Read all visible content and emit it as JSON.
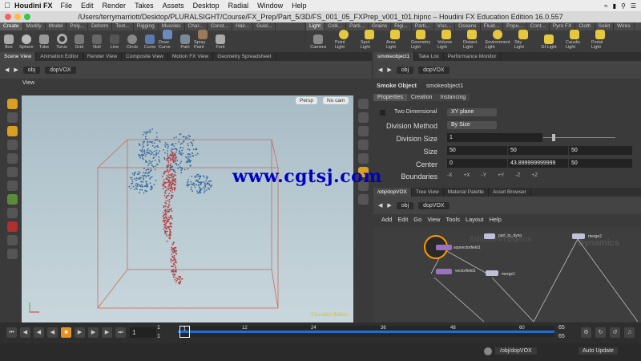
{
  "menubar": {
    "app_name": "Houdini FX",
    "items": [
      "File",
      "Edit",
      "Render",
      "Takes",
      "Assets",
      "Desktop",
      "Radial",
      "Window",
      "Help"
    ]
  },
  "titlebar": {
    "title": "/Users/terrymarriott/Desktop/PLURALSIGHT/Course/FX_Prep/Part_5/3D/FS_001_05_FXPrep_v001_t01.hipnc – Houdini FX Education Edition 16.0.557"
  },
  "shelf_left": {
    "tabs": [
      "Create",
      "Modify",
      "Model",
      "Poly...",
      "Deform",
      "Text...",
      "Rigging",
      "Muscles",
      "Char...",
      "Const...",
      "Hair...",
      "Guid..."
    ],
    "tools": [
      "Box",
      "Sphere",
      "Tube",
      "Torus",
      "Grid",
      "Null",
      "Line",
      "Circle",
      "Curve",
      "Draw Curve",
      "Path",
      "Spray Paint",
      "Font"
    ]
  },
  "shelf_right": {
    "tabs": [
      "Light",
      "Colli...",
      "Parti...",
      "Grains",
      "Rigi...",
      "Parti...",
      "Visc...",
      "Oceans",
      "Fluid...",
      "Popu...",
      "Cont...",
      "Pyro FX",
      "Cloth",
      "Solid",
      "Wires"
    ],
    "tools": [
      "Camera",
      "Point Light",
      "Spot Light",
      "Area Light",
      "Geometry Light",
      "Volume Light",
      "Distant Light",
      "Environment Light",
      "Sky Light",
      "GI Light",
      "Caustic Light",
      "Portal Light"
    ]
  },
  "left_pane": {
    "tabs": [
      "Scene View",
      "Animation Editor",
      "Render View",
      "Composite View",
      "Motion FX View",
      "Geometry Spreadsheet"
    ],
    "path": [
      "obj",
      "dopVOX"
    ],
    "view_label": "View",
    "persp": "Persp",
    "cam": "No cam",
    "edition": "Education Edition"
  },
  "param_pane": {
    "tabs": [
      "smokeobject1",
      "Take List",
      "Performance Monitor"
    ],
    "node_type": "Smoke Object",
    "node_name": "smokeobject1",
    "sub_tabs": [
      "Properties",
      "Creation",
      "Instancing"
    ],
    "two_dimensional_label": "Two Dimensional",
    "two_dimensional_value": "XY plane",
    "division_method_label": "Division Method",
    "division_method_value": "By Size",
    "division_size_label": "Division Size",
    "division_size_value": "1",
    "size_label": "Size",
    "size_values": [
      "50",
      "50",
      "50"
    ],
    "center_label": "Center",
    "center_values": [
      "0",
      "43.899999999999",
      "50"
    ],
    "boundaries_label": "Boundaries",
    "boundaries": [
      "-X",
      "+X",
      "-Y",
      "+Y",
      "-Z",
      "+Z"
    ]
  },
  "network_pane": {
    "tabs": [
      "/obj/dopVOX",
      "Tree View",
      "Material Palette",
      "Asset Browser"
    ],
    "path": [
      "obj",
      "dopVOX"
    ],
    "menu": [
      "Add",
      "Edit",
      "Go",
      "View",
      "Tools",
      "Layout",
      "Help"
    ],
    "watermark_edition": "Education Edition",
    "watermark_context": "Dynamics",
    "nodes": [
      "sopvectorfield1",
      "vectorfield1",
      "part_to_dyno",
      "merge1",
      "merge2"
    ]
  },
  "playbar": {
    "current_frame": "1",
    "start": "1",
    "start2": "1",
    "end": "65",
    "end2": "65",
    "ticks": [
      "1",
      "12",
      "24",
      "36",
      "48",
      "60"
    ]
  },
  "status": {
    "path": "/obj/dopVOX",
    "auto_update": "Auto Update"
  },
  "watermark": "www.cgtsj.com"
}
